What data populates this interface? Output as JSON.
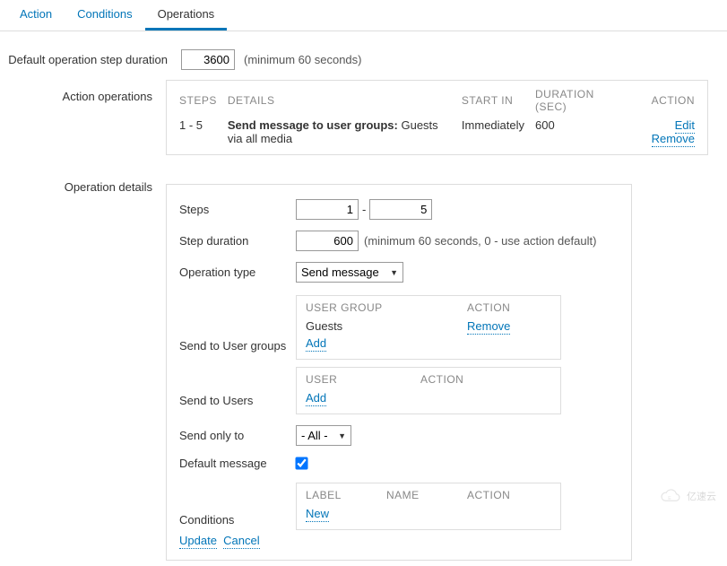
{
  "tabs": {
    "action": "Action",
    "conditions": "Conditions",
    "operations": "Operations"
  },
  "default_step": {
    "label": "Default operation step duration",
    "value": "3600",
    "hint": "(minimum 60 seconds)"
  },
  "action_ops": {
    "label": "Action operations",
    "headers": {
      "steps": "Steps",
      "details": "Details",
      "start": "Start in",
      "duration": "Duration (sec)",
      "action": "Action"
    },
    "row": {
      "steps": "1 - 5",
      "details_bold": "Send message to user groups:",
      "details_rest": " Guests via all media",
      "start": "Immediately",
      "duration": "600",
      "edit": "Edit",
      "remove": "Remove"
    }
  },
  "op_details": {
    "label": "Operation details",
    "steps_label": "Steps",
    "steps_from": "1",
    "steps_to": "5",
    "step_dur_label": "Step duration",
    "step_dur_value": "600",
    "step_dur_hint": "(minimum 60 seconds, 0 - use action default)",
    "op_type_label": "Operation type",
    "op_type_value": "Send message",
    "user_groups_label": "Send to User groups",
    "ug_header_group": "User group",
    "ug_header_action": "Action",
    "ug_row_name": "Guests",
    "ug_row_remove": "Remove",
    "ug_add": "Add",
    "users_label": "Send to Users",
    "u_header_user": "User",
    "u_header_action": "Action",
    "u_add": "Add",
    "send_only_label": "Send only to",
    "send_only_value": "- All -",
    "default_msg_label": "Default message",
    "conditions_label": "Conditions",
    "c_header_label": "Label",
    "c_header_name": "Name",
    "c_header_action": "Action",
    "c_new": "New",
    "update": "Update",
    "cancel": "Cancel"
  },
  "watermark": "亿速云"
}
